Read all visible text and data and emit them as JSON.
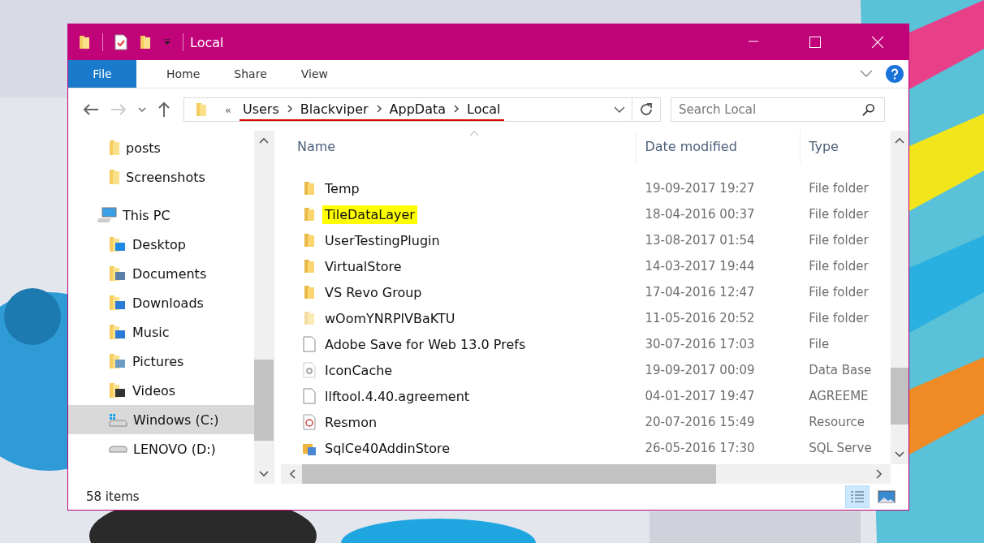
{
  "window": {
    "title": "Local"
  },
  "ribbon": {
    "tabs": [
      {
        "label": "File",
        "selected": true
      },
      {
        "label": "Home",
        "selected": false
      },
      {
        "label": "Share",
        "selected": false
      },
      {
        "label": "View",
        "selected": false
      }
    ]
  },
  "address_bar": {
    "overflow": "«",
    "path": [
      "Users",
      "Blackviper",
      "AppData",
      "Local"
    ],
    "underlined": true
  },
  "search": {
    "placeholder": "Search Local"
  },
  "sidebar": {
    "items": [
      {
        "label": "posts",
        "kind": "folder",
        "selected": false
      },
      {
        "label": "Screenshots",
        "kind": "folder",
        "selected": false
      },
      {
        "label": "This PC",
        "kind": "pc",
        "selected": false,
        "children": [
          {
            "label": "Desktop",
            "kind": "desktop",
            "selected": false
          },
          {
            "label": "Documents",
            "kind": "documents",
            "selected": false
          },
          {
            "label": "Downloads",
            "kind": "downloads",
            "selected": false
          },
          {
            "label": "Music",
            "kind": "music",
            "selected": false
          },
          {
            "label": "Pictures",
            "kind": "pictures",
            "selected": false
          },
          {
            "label": "Videos",
            "kind": "videos",
            "selected": false
          },
          {
            "label": "Windows (C:)",
            "kind": "system-drive",
            "selected": true
          },
          {
            "label": "LENOVO (D:)",
            "kind": "drive",
            "selected": false
          }
        ]
      }
    ]
  },
  "table": {
    "columns": [
      "Name",
      "Date modified",
      "Type"
    ],
    "rows": [
      {
        "name": "Temp",
        "date": "19-09-2017 19:27",
        "type": "File folder",
        "kind": "folder",
        "highlighted": false
      },
      {
        "name": "TileDataLayer",
        "date": "18-04-2016 00:37",
        "type": "File folder",
        "kind": "folder",
        "highlighted": true
      },
      {
        "name": "UserTestingPlugin",
        "date": "13-08-2017 01:54",
        "type": "File folder",
        "kind": "folder",
        "highlighted": false
      },
      {
        "name": "VirtualStore",
        "date": "14-03-2017 19:44",
        "type": "File folder",
        "kind": "folder",
        "highlighted": false
      },
      {
        "name": "VS Revo Group",
        "date": "17-04-2016 12:47",
        "type": "File folder",
        "kind": "folder",
        "highlighted": false
      },
      {
        "name": "wOomYNRPlVBaKTU",
        "date": "11-05-2016 20:52",
        "type": "File folder",
        "kind": "hidden-folder",
        "highlighted": false
      },
      {
        "name": "Adobe Save for Web 13.0 Prefs",
        "date": "30-07-2016 17:03",
        "type": "File",
        "kind": "file",
        "highlighted": false
      },
      {
        "name": "IconCache",
        "date": "19-09-2017 00:09",
        "type": "Data Base",
        "kind": "gear-file",
        "highlighted": false
      },
      {
        "name": "llftool.4.40.agreement",
        "date": "04-01-2017 19:47",
        "type": "AGREEME",
        "kind": "file",
        "highlighted": false
      },
      {
        "name": "Resmon",
        "date": "20-07-2016 15:49",
        "type": "Resource",
        "kind": "gauge-file",
        "highlighted": false
      },
      {
        "name": "SqlCe40AddinStore",
        "date": "26-05-2016 17:30",
        "type": "SQL Serve",
        "kind": "package-file",
        "highlighted": false
      }
    ]
  },
  "status_bar": {
    "item_count": "58 items"
  }
}
